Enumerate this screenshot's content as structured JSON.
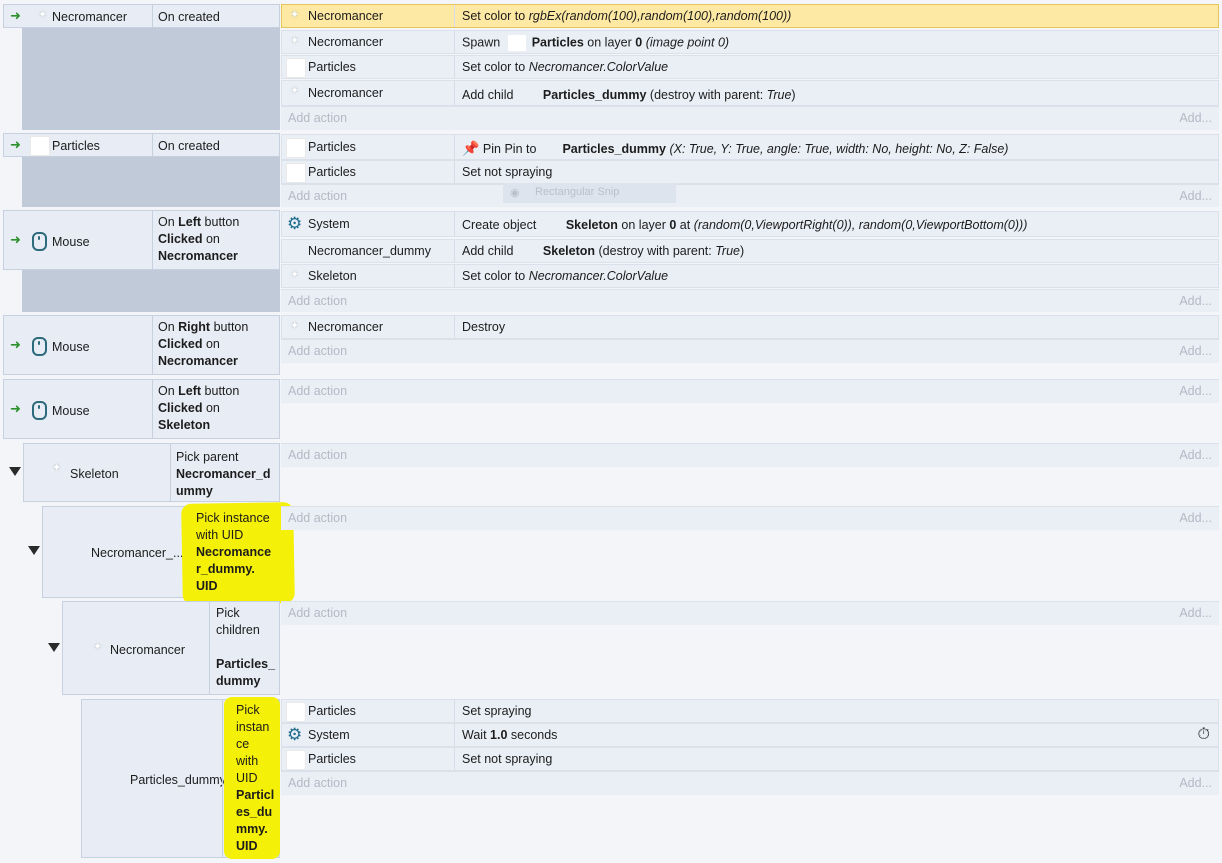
{
  "events": {
    "e1": {
      "object": "Necromancer",
      "condition": "On created",
      "actions": [
        {
          "object": "Necromancer",
          "text_pre": "Set color to ",
          "italic": "rgbEx(random(100),random(100),random(100))"
        },
        {
          "object": "Necromancer",
          "text_pre": "Spawn ",
          "bold": "Particles",
          "text_mid": " on layer ",
          "bold2": "0",
          "italic": "(image point 0)"
        },
        {
          "object": "Particles",
          "text_pre": "Set color to ",
          "italic": "Necromancer.ColorValue"
        },
        {
          "object": "Necromancer",
          "text_pre": "Add child ",
          "bold": "Particles_dummy",
          "text_mid": "(destroy with parent: ",
          "italic": "True",
          "text_post": ")"
        }
      ]
    },
    "e2": {
      "object": "Particles",
      "condition": "On created",
      "actions": [
        {
          "object": "Particles",
          "pin_label": "Pin Pin to",
          "bold": "Particles_dummy",
          "detail": "(X: True, Y: True, angle: True, width: No, height: No, Z: False)"
        },
        {
          "object": "Particles",
          "text": "Set not spraying"
        }
      ],
      "ghost_tooltip": "Rectangular Snip"
    },
    "e3": {
      "object": "Mouse",
      "cond_line1_pre": "On ",
      "cond_line1_bold": "Left",
      "cond_line1_post": " button",
      "cond_line2_bold": "Clicked",
      "cond_line2_post": " on",
      "cond_line3_bold": "Necromancer",
      "actions": [
        {
          "object": "System",
          "text_pre": "Create object ",
          "bold": "Skeleton",
          "text_mid": " on layer ",
          "bold2": "0",
          "text_post": " at ",
          "italic": "(random(0,ViewportRight(0)), random(0,ViewportBottom(0)))"
        },
        {
          "object": "Necromancer_dummy",
          "text_pre": "Add child ",
          "bold": "Skeleton",
          "text_mid": "(destroy with parent: ",
          "italic": "True",
          "text_post": ")"
        },
        {
          "object": "Skeleton",
          "text_pre": "Set color to ",
          "italic": "Necromancer.ColorValue"
        }
      ]
    },
    "e4": {
      "object": "Mouse",
      "cond_line1_pre": "On ",
      "cond_line1_bold": "Right",
      "cond_line1_post": " button",
      "cond_line2_bold": "Clicked",
      "cond_line2_post": " on",
      "cond_line3_bold": "Necromancer",
      "actions": [
        {
          "object": "Necromancer",
          "text": "Destroy"
        }
      ]
    },
    "e5": {
      "object": "Mouse",
      "cond_line1_pre": "On ",
      "cond_line1_bold": "Left",
      "cond_line1_post": " button",
      "cond_line2_bold": "Clicked",
      "cond_line2_post": " on",
      "cond_line3_bold": "Skeleton"
    },
    "s1": {
      "object": "Skeleton",
      "line1": "Pick parent",
      "line2": "Necromancer_d",
      "line3": "ummy"
    },
    "s2": {
      "object": "Necromancer_...",
      "line1": "Pick instance",
      "line2": "with UID",
      "line3": "Necromance",
      "line4": "r_dummy.",
      "line5": "UID"
    },
    "s3": {
      "object": "Necromancer",
      "line1": "Pick",
      "line2": "children",
      "line3": "Particles_",
      "line4": "dummy"
    },
    "s4": {
      "object": "Particles_dummy",
      "lines": [
        "Pick",
        "instan",
        "ce",
        "with",
        "UID"
      ],
      "bold_lines": [
        "Particl",
        "es_du",
        "mmy.",
        "UID"
      ],
      "actions": [
        {
          "object": "Particles",
          "text": "Set spraying"
        },
        {
          "object": "System",
          "text_pre": "Wait ",
          "bold": "1.0",
          "text_post": " seconds"
        },
        {
          "object": "Particles",
          "text": "Set not spraying"
        }
      ]
    }
  },
  "add_action_label": "Add action",
  "add_short_label": "Add...",
  "colors": {
    "highlight": "#f5f007",
    "selected_row": "#fde9a3",
    "trigger_arrow": "#2c8f2c"
  }
}
